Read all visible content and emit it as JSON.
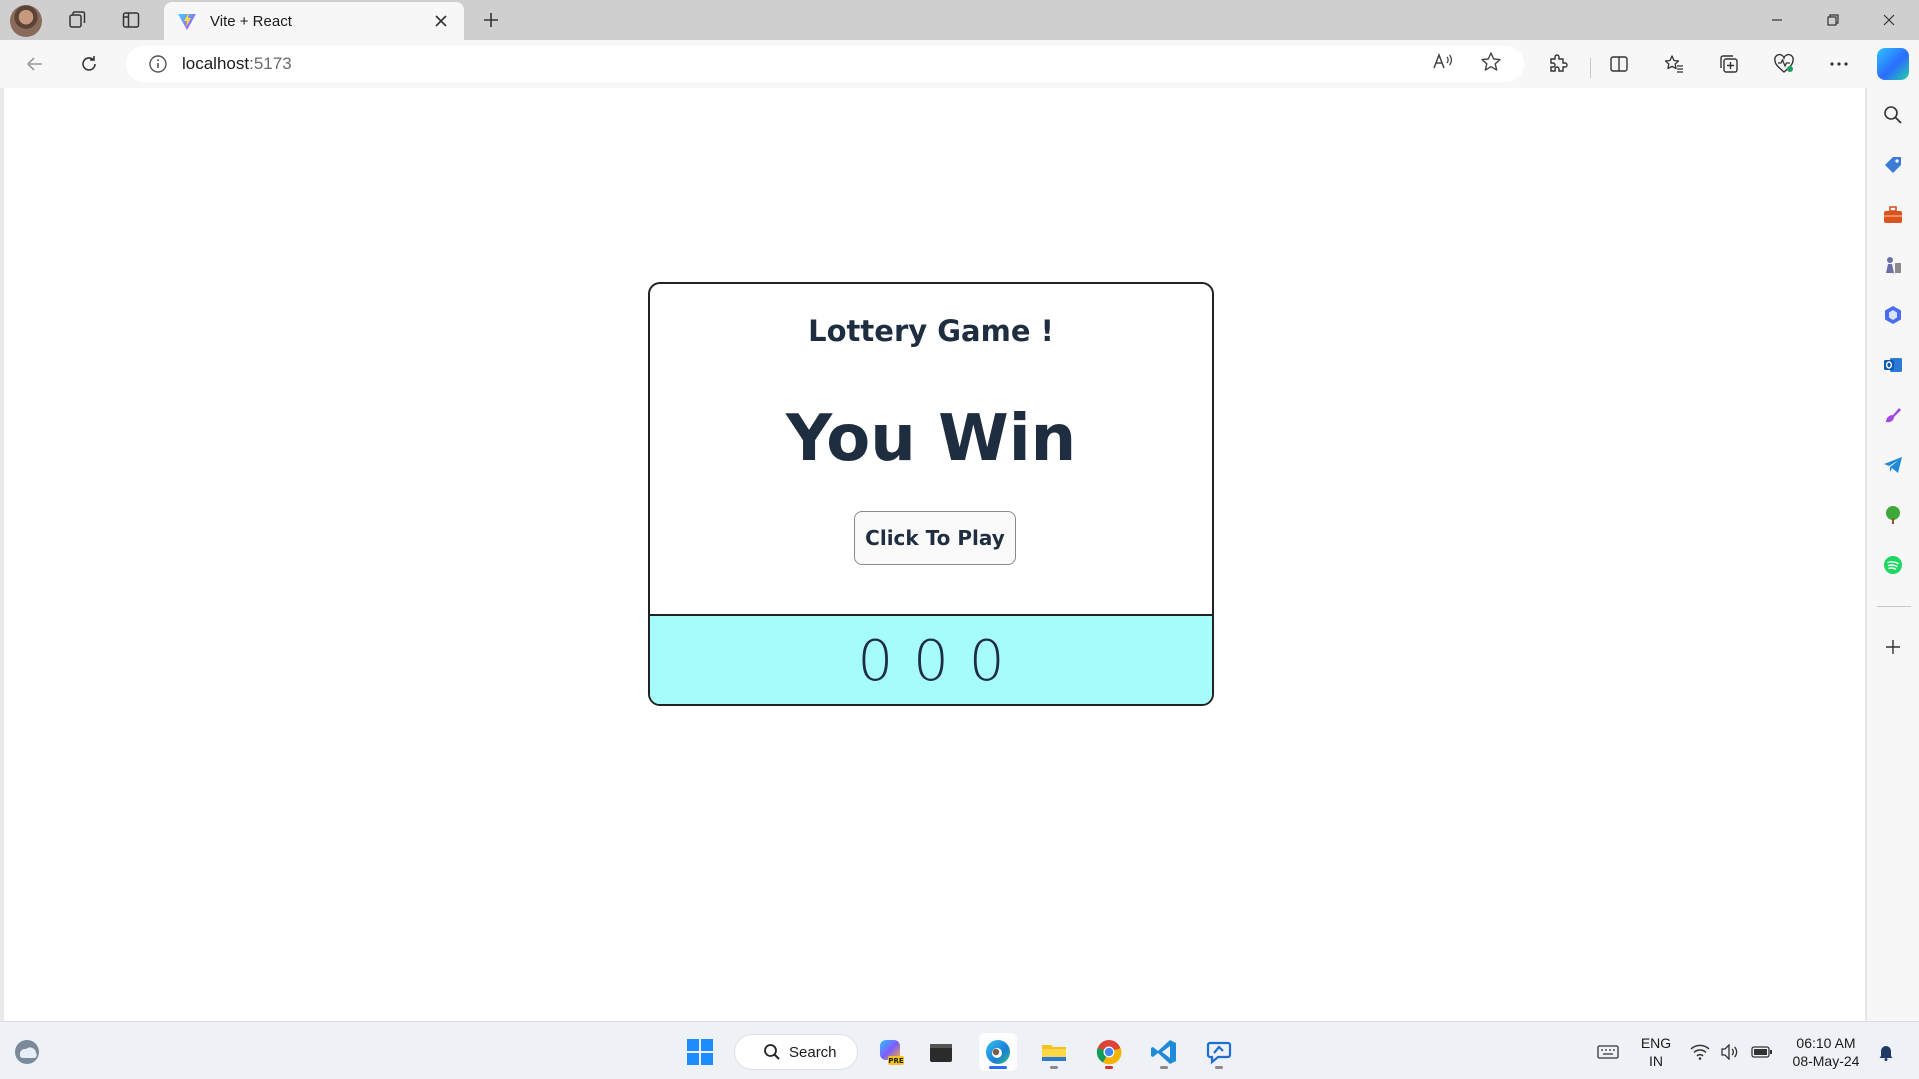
{
  "browser": {
    "tab": {
      "title": "Vite + React"
    },
    "address": {
      "host": "localhost",
      "port": ":5173"
    }
  },
  "page": {
    "heading": "Lottery Game !",
    "result": "You Win",
    "play_button": "Click To Play",
    "ticket_digits": [
      "0",
      "0",
      "0"
    ]
  },
  "taskbar": {
    "search_label": "Search",
    "lang_top": "ENG",
    "lang_bottom": "IN",
    "time": "06:10 AM",
    "date": "08-May-24"
  },
  "colors": {
    "ticket_bg": "#a6fbfb",
    "heading_text": "#1e2d3f",
    "accent": "#2b6cff"
  }
}
